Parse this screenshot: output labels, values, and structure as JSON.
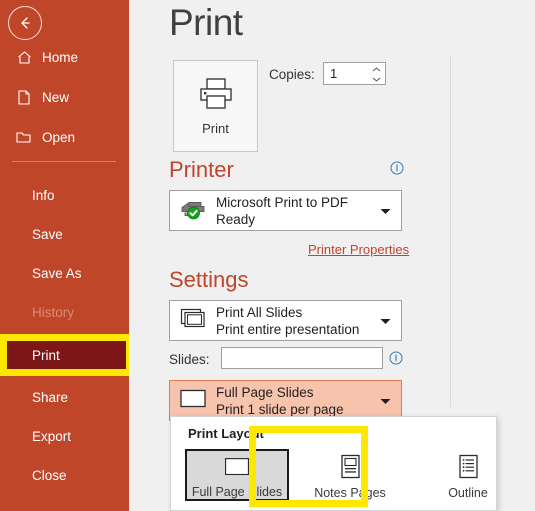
{
  "app": {
    "page_title": "Print",
    "accent_color": "#c0452b",
    "sidebar_color": "#c0462a",
    "active_item_color": "#7d1616",
    "highlight_color": "#ffe800",
    "selected_combo_color": "#f8c3ad"
  },
  "sidebar": {
    "back_label": "Back",
    "items": [
      {
        "label": "Home",
        "icon": "home-icon",
        "state": "normal",
        "indent": false
      },
      {
        "label": "New",
        "icon": "page-icon",
        "state": "normal",
        "indent": false
      },
      {
        "label": "Open",
        "icon": "folder-icon",
        "state": "normal",
        "indent": false
      },
      {
        "label": "Info",
        "icon": "",
        "state": "normal",
        "indent": true
      },
      {
        "label": "Save",
        "icon": "",
        "state": "normal",
        "indent": true
      },
      {
        "label": "Save As",
        "icon": "",
        "state": "normal",
        "indent": true
      },
      {
        "label": "History",
        "icon": "",
        "state": "disabled",
        "indent": true
      },
      {
        "label": "Print",
        "icon": "",
        "state": "active",
        "indent": true
      },
      {
        "label": "Share",
        "icon": "",
        "state": "normal",
        "indent": true
      },
      {
        "label": "Export",
        "icon": "",
        "state": "normal",
        "indent": true
      },
      {
        "label": "Close",
        "icon": "",
        "state": "normal",
        "indent": true
      }
    ]
  },
  "print_action": {
    "button_label": "Print",
    "copies_label": "Copies:",
    "copies_value": "1"
  },
  "printer_section": {
    "heading": "Printer",
    "name": "Microsoft Print to PDF",
    "status": "Ready",
    "properties_link": "Printer Properties",
    "info_icon": "info-icon"
  },
  "settings_section": {
    "heading": "Settings",
    "range": {
      "line1": "Print All Slides",
      "line2": "Print entire presentation"
    },
    "slides_label": "Slides:",
    "slides_value": "",
    "slides_placeholder": "",
    "layout": {
      "line1": "Full Page Slides",
      "line2": "Print 1 slide per page"
    }
  },
  "layout_dropdown": {
    "title": "Print Layout",
    "options": [
      {
        "label": "Full Page Slides",
        "icon": "full-page-slide-icon",
        "selected": true
      },
      {
        "label": "Notes Pages",
        "icon": "notes-page-icon",
        "selected": false
      },
      {
        "label": "Outline",
        "icon": "outline-icon",
        "selected": false
      }
    ]
  }
}
